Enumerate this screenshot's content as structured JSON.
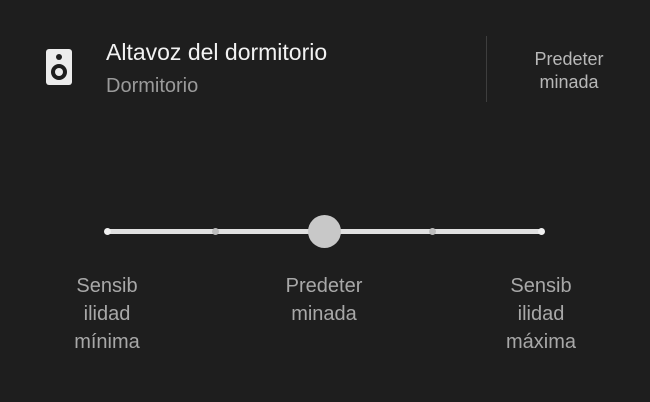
{
  "device": {
    "icon": "speaker-icon",
    "title": "Altavoz del dormitorio",
    "subtitle": "Dormitorio"
  },
  "default_button": {
    "lines": [
      "Predeter",
      "minada"
    ]
  },
  "sensitivity": {
    "stops": 5,
    "selected_index": 2,
    "level_fraction": 0.5,
    "labels": [
      {
        "lines": [
          "Sensib",
          "ilidad",
          "mínima"
        ]
      },
      {
        "lines": [
          "Predeter",
          "minada"
        ]
      },
      {
        "lines": [
          "Sensib",
          "ilidad",
          "máxima"
        ]
      }
    ]
  },
  "colors": {
    "background": "#1e1e1e",
    "track": "#e0e0e0",
    "thumb": "#c8c8c8",
    "secondary_text": "#9a9a9a"
  }
}
